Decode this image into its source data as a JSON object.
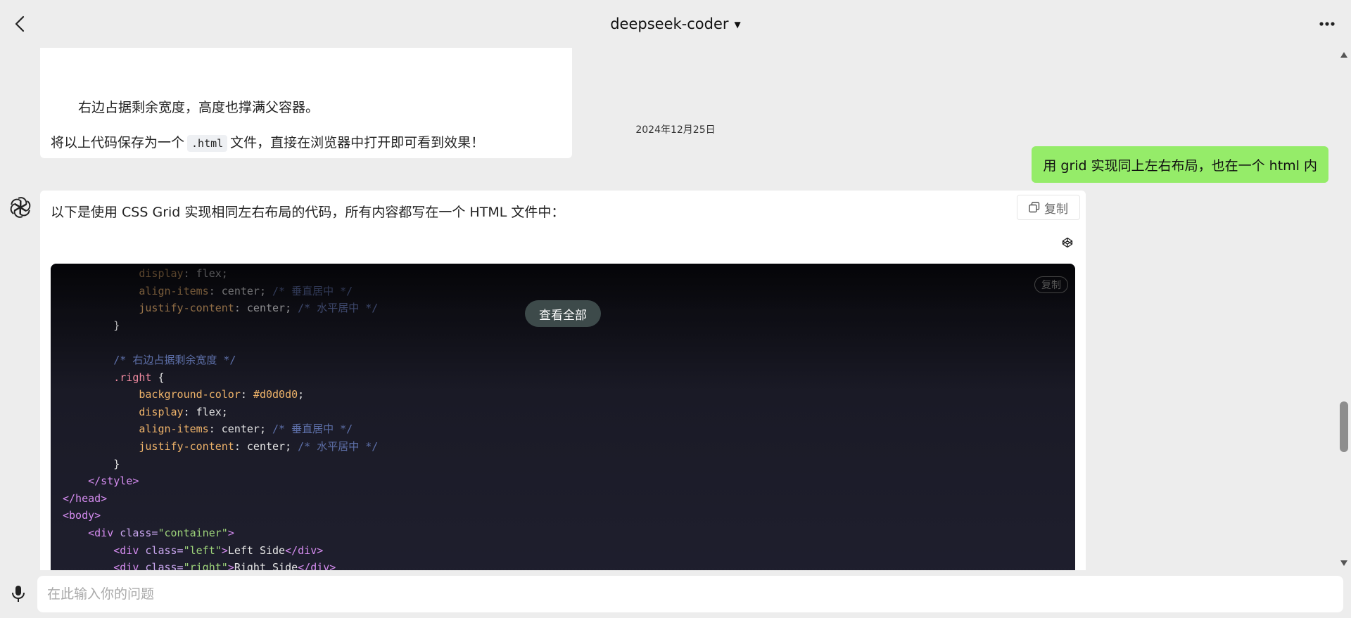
{
  "header": {
    "title": "deepseek-coder",
    "caret": "▼"
  },
  "messages": {
    "previous_bot": {
      "line1": "右边占据剩余宽度，高度也撑满父容器。",
      "line2_before": "将以上代码保存为一个",
      "line2_code": ".html",
      "line2_after": "文件，直接在浏览器中打开即可看到效果！"
    },
    "date": "2024年12月25日",
    "user": "用 grid 实现同上左右布局，也在一个 html 内",
    "bot": {
      "intro": "以下是使用 CSS Grid 实现相同左右布局的代码，所有内容都写在一个 HTML 文件中：",
      "copy_label": "复制",
      "code_copy_label": "复制",
      "view_all_label": "查看全部"
    }
  },
  "code": {
    "l1_prop": "display",
    "l1_val": ": flex;",
    "l2_prop": "align-items",
    "l2_val": ": center; ",
    "l2_com": "/* 垂直居中 */",
    "l3_prop": "justify-content",
    "l3_val": ": center; ",
    "l3_com": "/* 水平居中 */",
    "l4": "}",
    "l6_com": "/* 右边占据剩余宽度 */",
    "l7_sel": ".right",
    "l7_brace": " {",
    "l8_prop": "background-color",
    "l8_colon": ": ",
    "l8_val": "#d0d0d0",
    "l8_semi": ";",
    "l9_prop": "display",
    "l9_val": ": flex;",
    "l10_prop": "align-items",
    "l10_val": ": center; ",
    "l10_com": "/* 垂直居中 */",
    "l11_prop": "justify-content",
    "l11_val": ": center; ",
    "l11_com": "/* 水平居中 */",
    "l12": "}",
    "l13": "</style>",
    "l14": "</head>",
    "l15": "<body>",
    "l16_tag": "<div ",
    "l16_attr": "class=",
    "l16_str": "\"container\"",
    "l16_end": ">",
    "l17_tag": "<div ",
    "l17_attr": "class=",
    "l17_str": "\"left\"",
    "l17_end": ">",
    "l17_txt": "Left Side",
    "l17_close": "</div>",
    "l18_tag": "<div ",
    "l18_attr": "class=",
    "l18_str": "\"right\"",
    "l18_end": ">",
    "l18_txt": "Right Side",
    "l18_close": "</div>"
  },
  "input": {
    "placeholder": "在此输入你的问题"
  }
}
